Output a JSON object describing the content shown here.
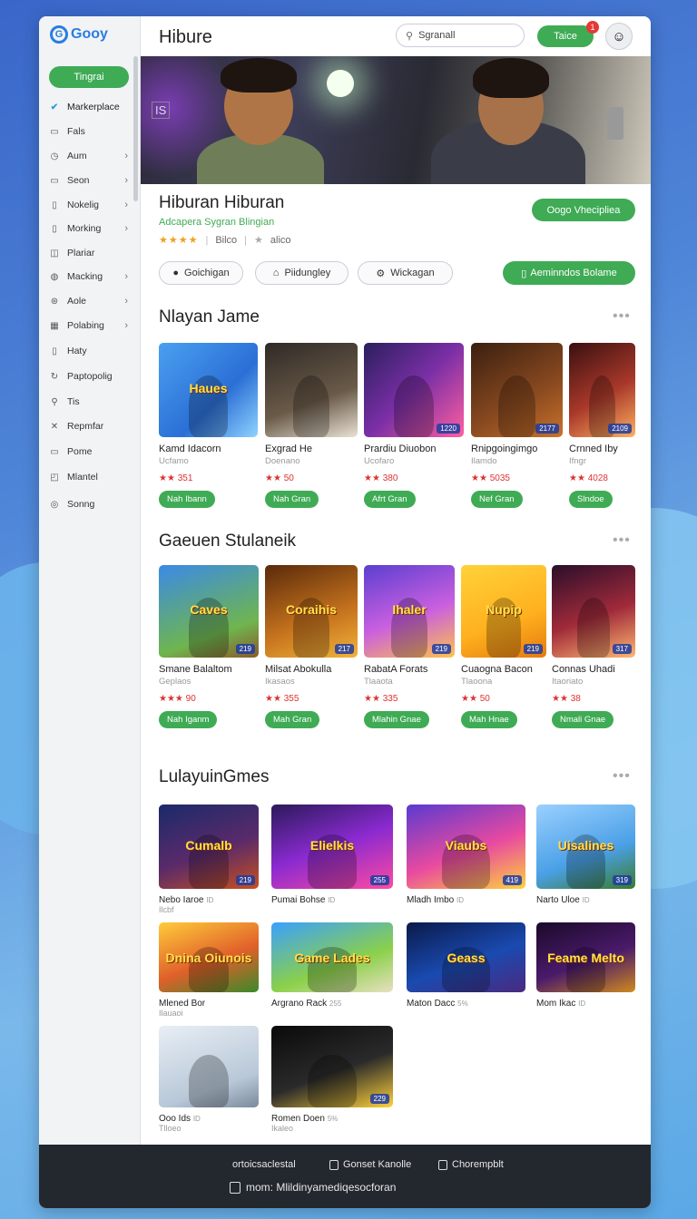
{
  "brand": {
    "name": "Gooy"
  },
  "sidebar": {
    "cta_label": "Tingrai",
    "items": [
      {
        "label": "Markerplace",
        "icon": "check-icon",
        "glyph": "✔",
        "chevron": false,
        "active": true
      },
      {
        "label": "Fals",
        "icon": "file-icon",
        "glyph": "▭",
        "chevron": false
      },
      {
        "label": "Aum",
        "icon": "clock-icon",
        "glyph": "◷",
        "chevron": true
      },
      {
        "label": "Seon",
        "icon": "folder-icon",
        "glyph": "▭",
        "chevron": true
      },
      {
        "label": "Nokelig",
        "icon": "lock-icon",
        "glyph": "▯",
        "chevron": true
      },
      {
        "label": "Morking",
        "icon": "document-icon",
        "glyph": "▯",
        "chevron": true
      },
      {
        "label": "Plariar",
        "icon": "book-icon",
        "glyph": "◫",
        "chevron": false
      },
      {
        "label": "Macking",
        "icon": "globe-icon",
        "glyph": "◍",
        "chevron": true
      },
      {
        "label": "Aole",
        "icon": "star-icon",
        "glyph": "⊛",
        "chevron": true
      },
      {
        "label": "Polabing",
        "icon": "grid-icon",
        "glyph": "▦",
        "chevron": true
      },
      {
        "label": "Haty",
        "icon": "bookmark-icon",
        "glyph": "▯",
        "chevron": false
      },
      {
        "label": "Paptopolig",
        "icon": "refresh-icon",
        "glyph": "↻",
        "chevron": false
      },
      {
        "label": "Tis",
        "icon": "search-icon",
        "glyph": "⚲",
        "chevron": false
      },
      {
        "label": "Repmfar",
        "icon": "tools-icon",
        "glyph": "✕",
        "chevron": false
      },
      {
        "label": "Pome",
        "icon": "image-icon",
        "glyph": "▭",
        "chevron": false
      },
      {
        "label": "Mlantel",
        "icon": "box-icon",
        "glyph": "◰",
        "chevron": false
      },
      {
        "label": "Sonng",
        "icon": "settings-icon",
        "glyph": "◎",
        "chevron": false
      }
    ]
  },
  "header": {
    "title": "Hibure",
    "search_placeholder": "Sgranall",
    "button_label": "Taice",
    "notification_count": "1"
  },
  "hero": {
    "tag": "IS"
  },
  "game": {
    "title": "Hiburan Hiburan",
    "subtitle": "Adcapera Sygran Blingian",
    "stars": "★★★★",
    "rating_meta": "Bilco",
    "rating_meta2": "alico",
    "primary_button": "Oogo Vhecipliea",
    "tabs": [
      "Goichigan",
      "Piidungley",
      "Wickagan"
    ],
    "wide_button": "Aeminndos Bolame"
  },
  "colors": {
    "accent": "#3fab55",
    "brand": "#2a7de1",
    "footer": "#23272e"
  },
  "sections": {
    "s1": {
      "title": "Nlayan Jame",
      "cards": [
        {
          "name": "Kamd Idacorn",
          "sub": "Ucfamo",
          "rating": "★★ 351",
          "button": "Nah Ibann",
          "badge": "",
          "art": "Haues"
        },
        {
          "name": "Exgrad He",
          "sub": "Doenano",
          "rating": "★★ 50",
          "button": "Nah Gran",
          "badge": "",
          "art": ""
        },
        {
          "name": "Prardiu Diuobon",
          "sub": "Ucofaro",
          "rating": "★★ 380",
          "button": "Afrt Gran",
          "badge": "1220",
          "art": ""
        },
        {
          "name": "Rnipgoingimgo",
          "sub": "Ilamdo",
          "rating": "★★ 5035",
          "button": "Nef Gran",
          "badge": "2177",
          "art": ""
        },
        {
          "name": "Crnned Iby",
          "sub": "Ifngr",
          "rating": "★★ 4028",
          "button": "Slndoe",
          "badge": "2109",
          "art": ""
        }
      ]
    },
    "s2": {
      "title": "Gaeuen Stulaneik",
      "cards": [
        {
          "name": "Smane Balaltom",
          "sub": "Geplaos",
          "rating": "★★★ 90",
          "button": "Nah Iganm",
          "badge": "219",
          "art": "Caves"
        },
        {
          "name": "Milsat Abokulla",
          "sub": "Ikasaos",
          "rating": "★★ 355",
          "button": "Mah Gran",
          "badge": "217",
          "art": "Coraihis"
        },
        {
          "name": "RabatA Forats",
          "sub": "Tlaaota",
          "rating": "★★ 335",
          "button": "Mlahin Gnae",
          "badge": "219",
          "art": "Ihaler"
        },
        {
          "name": "Cuaogna Bacon",
          "sub": "Tlaoona",
          "rating": "★★ 50",
          "button": "Mah Hnae",
          "badge": "219",
          "art": "Nupip"
        },
        {
          "name": "Connas Uhadi",
          "sub": "Itaoriato",
          "rating": "★★ 38",
          "button": "Nmali Gnae",
          "badge": "317",
          "art": ""
        }
      ]
    },
    "s3": {
      "title": "LulayuinGmes",
      "cards": [
        {
          "name": "Nebo Iaroe",
          "sm": "ID",
          "sub": "Ilcbf",
          "badge": "219",
          "art": "Cumalb"
        },
        {
          "name": "Pumai Bohse",
          "sm": "ID",
          "sub": "",
          "badge": "255",
          "art": "Elielkis"
        },
        {
          "name": "Mladh Imbo",
          "sm": "ID",
          "sub": "",
          "badge": "419",
          "art": "Viaubs"
        },
        {
          "name": "Narto Uloe",
          "sm": "ID",
          "sub": "",
          "badge": "319",
          "art": "Uisalines"
        },
        {
          "name": "Mlened Bor",
          "sm": "",
          "sub": "Ilauaoi",
          "badge": "",
          "art": "Dnina Oiunois"
        },
        {
          "name": "Argrano Rack",
          "sm": "255",
          "sub": "",
          "badge": "",
          "art": "Game Lades"
        },
        {
          "name": "Maton Dacc",
          "sm": "5%",
          "sub": "",
          "badge": "",
          "art": "Geass"
        },
        {
          "name": "Mom Ikac",
          "sm": "ID",
          "sub": "",
          "badge": "",
          "art": "Feame Melto"
        },
        {
          "name": "Ooo Ids",
          "sm": "ID",
          "sub": "Tlloeo",
          "badge": "",
          "art": ""
        },
        {
          "name": "Romen Doen",
          "sm": "5%",
          "sub": "Ikaleo",
          "badge": "229",
          "art": ""
        }
      ]
    }
  },
  "footer": {
    "link1": "ortoicsaclestal",
    "link2": "Gonset Kanolle",
    "link3": "Chorempblt",
    "bottom": "mom: Mlildinyamediqesocforan"
  }
}
